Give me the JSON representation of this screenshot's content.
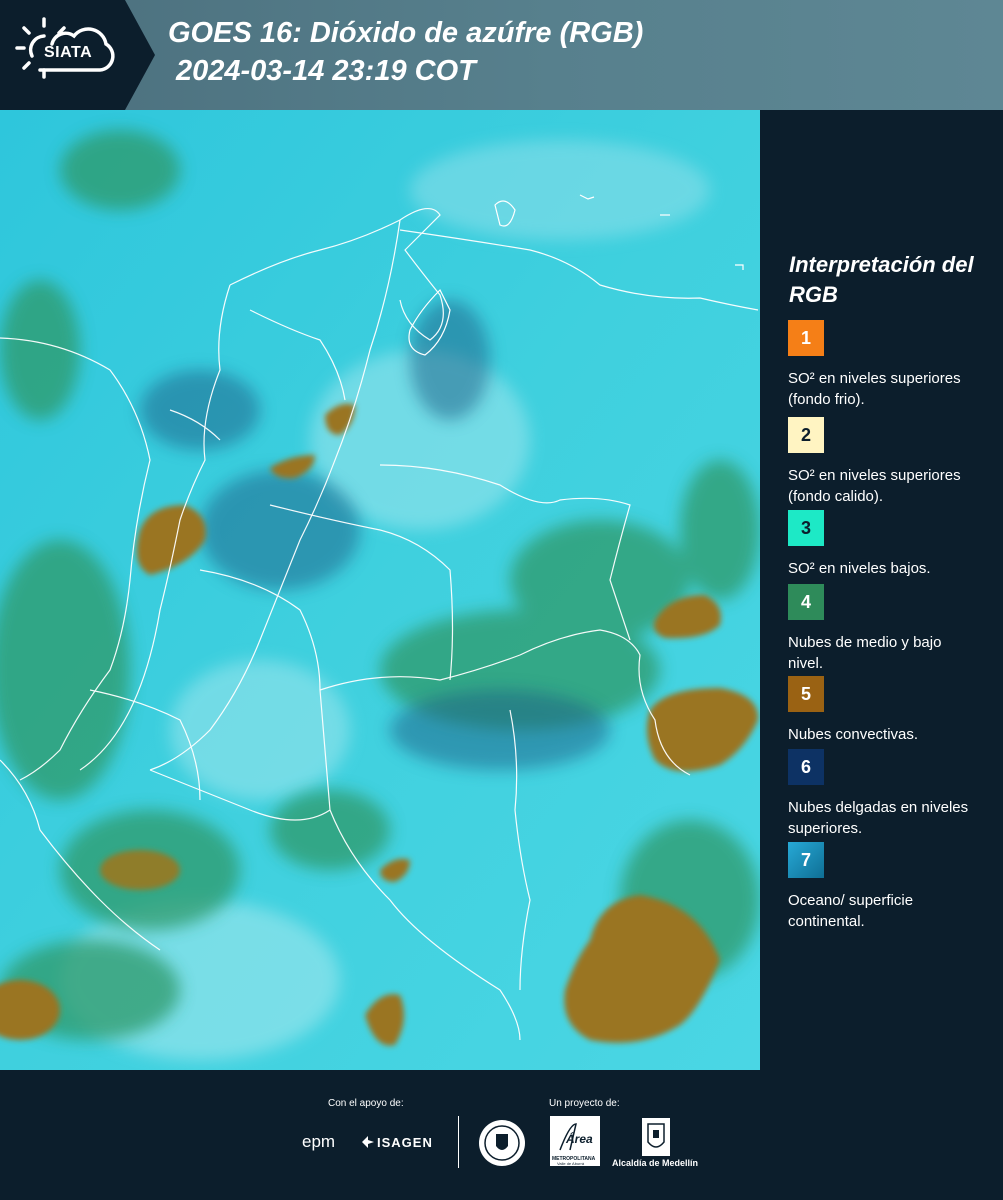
{
  "header": {
    "brand": "SIATA",
    "title_line1": "GOES 16: Dióxido de azúfre (RGB)",
    "title_line2": "2024-03-14 23:19 COT"
  },
  "legend": {
    "title": "Interpretación del RGB",
    "items": [
      {
        "num": "1",
        "color": "#f57f17",
        "label": "SO² en niveles superiores (fondo frio)."
      },
      {
        "num": "2",
        "color": "#fff4c2",
        "label": "SO² en niveles superiores (fondo calido)."
      },
      {
        "num": "3",
        "color": "#1de9c6",
        "label": "SO² en niveles bajos."
      },
      {
        "num": "4",
        "color": "#2e8b5a",
        "label": "Nubes de medio y bajo nivel."
      },
      {
        "num": "5",
        "color": "#9a6213",
        "label": "Nubes convectivas."
      },
      {
        "num": "6",
        "color": "#0d3264",
        "label": "Nubes delgadas en niveles superiores."
      },
      {
        "num": "7",
        "color": "#1b8fb5",
        "label": "Oceano/ superficie continental."
      }
    ]
  },
  "footer": {
    "support_label": "Con el apoyo de:",
    "project_label": "Un proyecto de:",
    "logos": {
      "epm": "epm",
      "isagen": "ISAGEN",
      "area": "Área",
      "area_sub1": "METROPOLITANA",
      "area_sub2": "Valle de Aburrá",
      "alcaldia": "Alcaldía de Medellín"
    }
  }
}
